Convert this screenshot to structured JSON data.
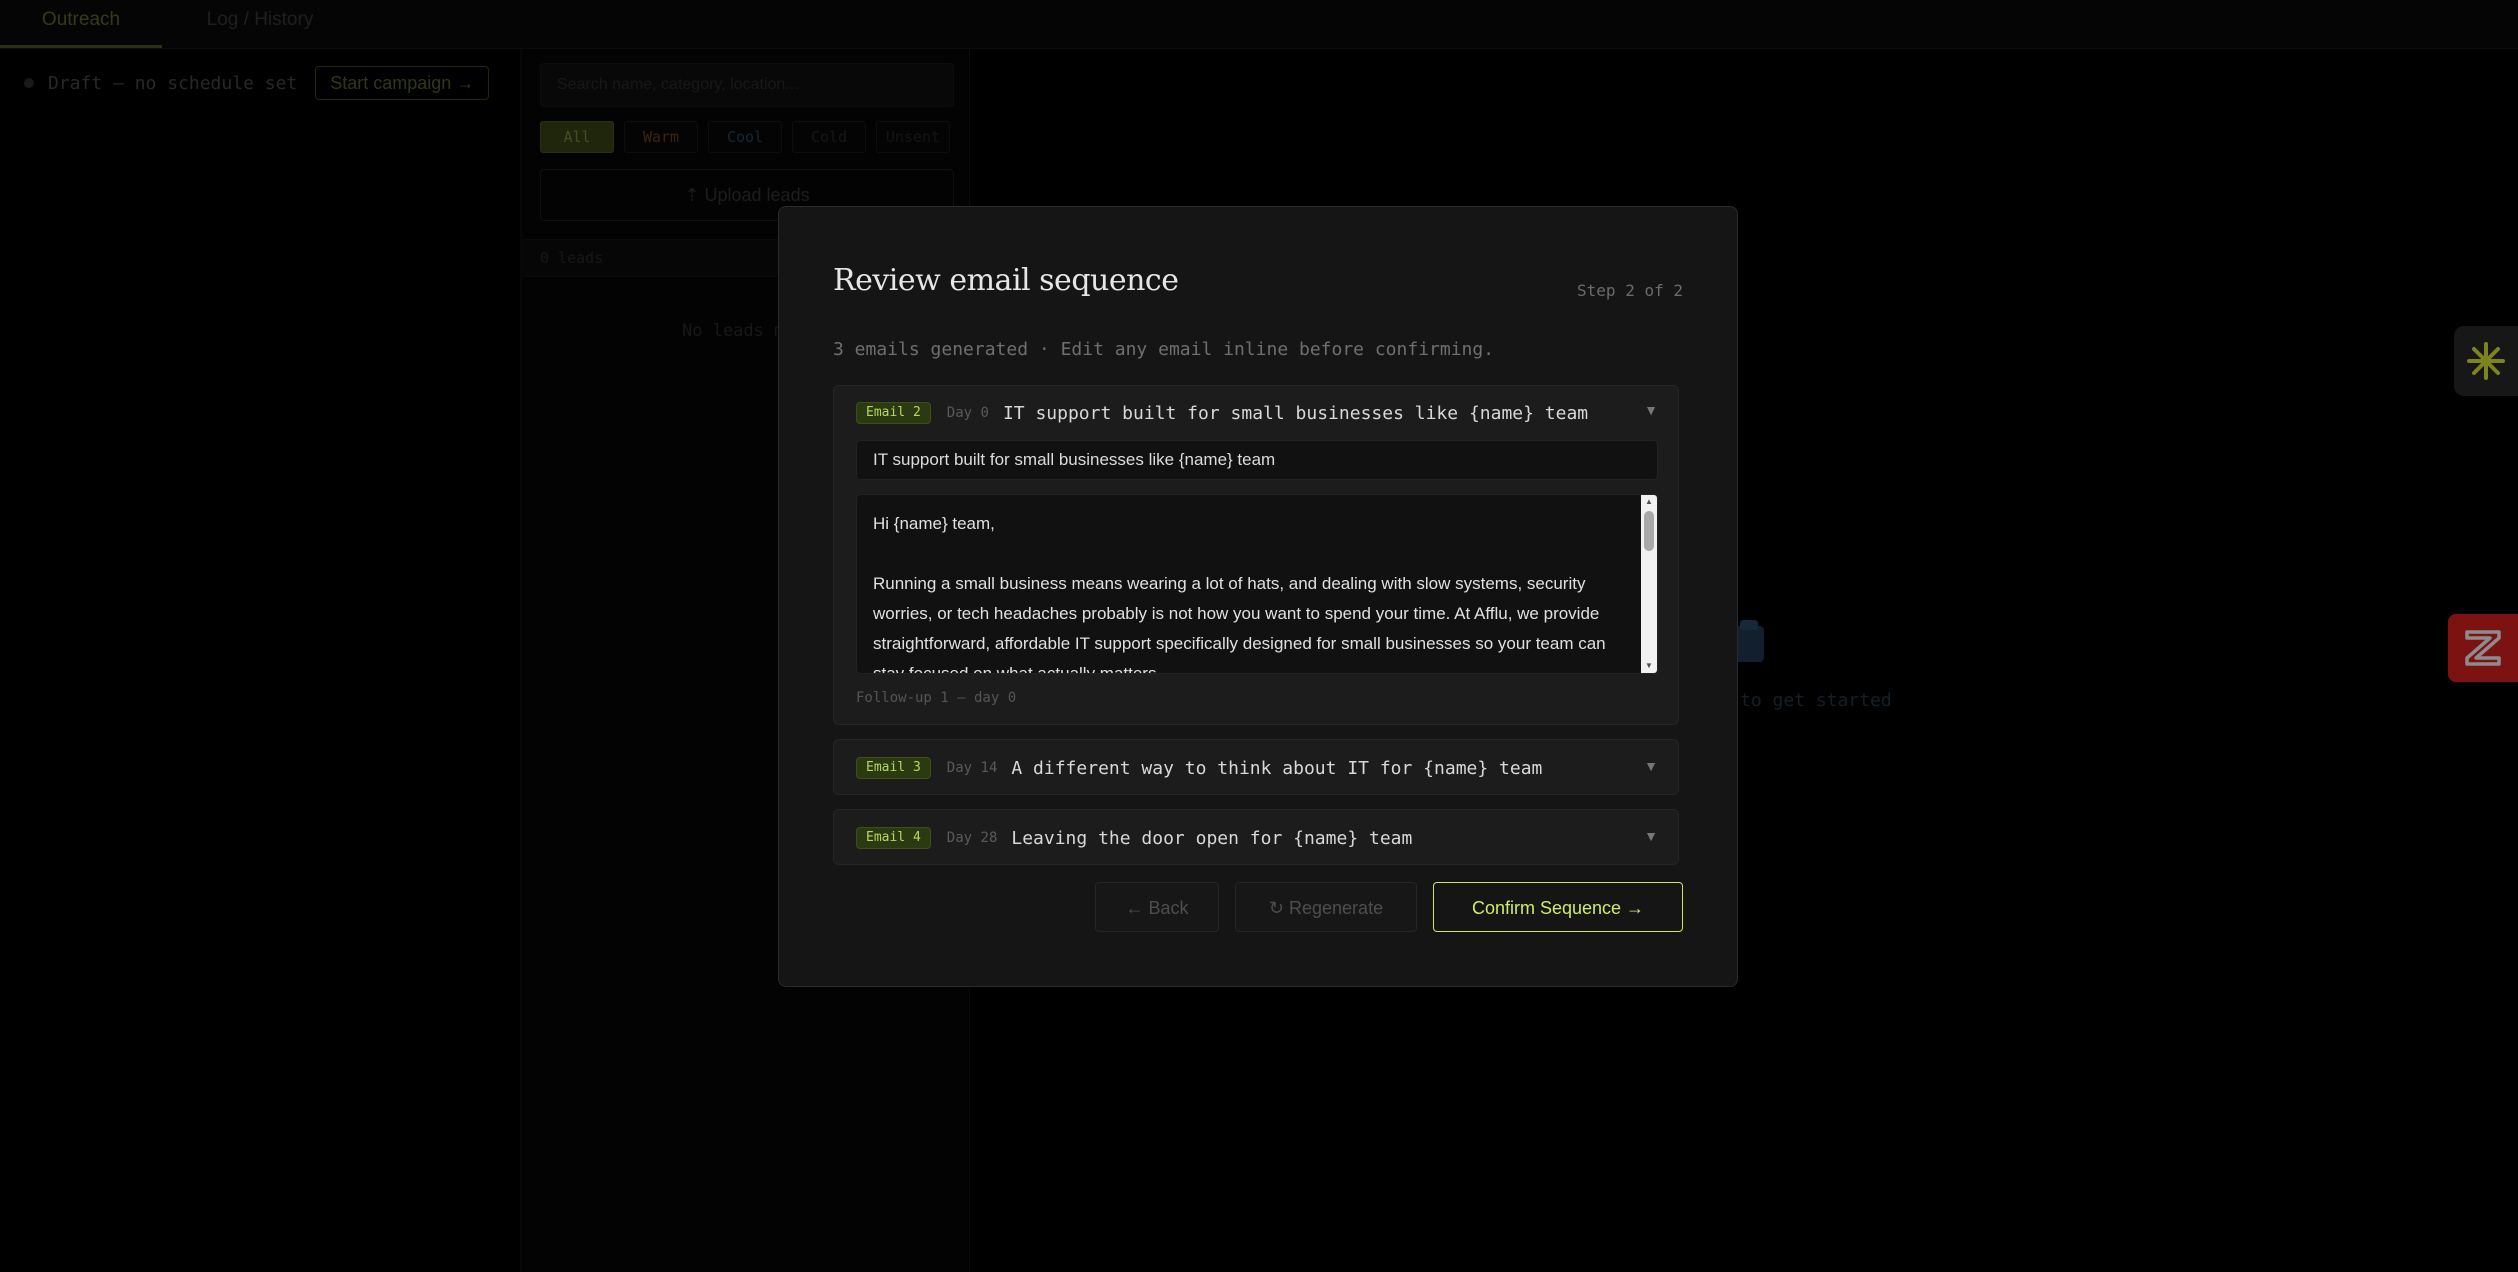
{
  "tabs": [
    {
      "label": "Outreach",
      "active": true
    },
    {
      "label": "Log / History",
      "active": false
    }
  ],
  "campaign": {
    "status_text": "Draft — no schedule set",
    "start_button": "Start campaign →"
  },
  "leads_panel": {
    "search_placeholder": "Search name, category, location...",
    "filters": [
      "All",
      "Warm",
      "Cool",
      "Cold",
      "Unsent"
    ],
    "active_filter": "All",
    "upload_label": "⇡ Upload leads",
    "leads_count": "0 leads",
    "empty_text": "No leads m"
  },
  "main": {
    "empty_hint": "to get started"
  },
  "modal": {
    "title": "Review email sequence",
    "step": "Step 2 of 2",
    "subtitle": "3 emails generated · Edit any email inline before confirming.",
    "emails": [
      {
        "badge": "Email 2",
        "day": "Day 0",
        "subject": "IT support built for small businesses like {name} team",
        "expanded": true,
        "subject_value": "IT support built for small businesses like {name} team",
        "body_greeting": "Hi {name} team,",
        "body_paragraph": "Running a small business means wearing a lot of hats, and dealing with slow systems, security worries, or tech headaches probably is not how you want to spend your time. At Afflu, we provide straightforward, affordable IT support specifically designed for small businesses so your team can stay focused on what actually matters.",
        "followup": "Follow-up 1 — day 0"
      },
      {
        "badge": "Email 3",
        "day": "Day 14",
        "subject": "A different way to think about IT for {name} team",
        "expanded": false
      },
      {
        "badge": "Email 4",
        "day": "Day 28",
        "subject": "Leaving the door open for {name} team",
        "expanded": false
      }
    ],
    "buttons": {
      "back": "← Back",
      "regenerate": "↻ Regenerate",
      "confirm": "Confirm Sequence →"
    }
  },
  "colors": {
    "accent": "#cdee62",
    "badge_bg": "#2c3a12",
    "widget_red": "#e32124",
    "spark_yellow": "#e2f032"
  },
  "icons": {
    "spark_widget": "asterisk-spark-icon",
    "z_widget": "z-logo-icon",
    "chevron": "chevron-down-icon"
  }
}
